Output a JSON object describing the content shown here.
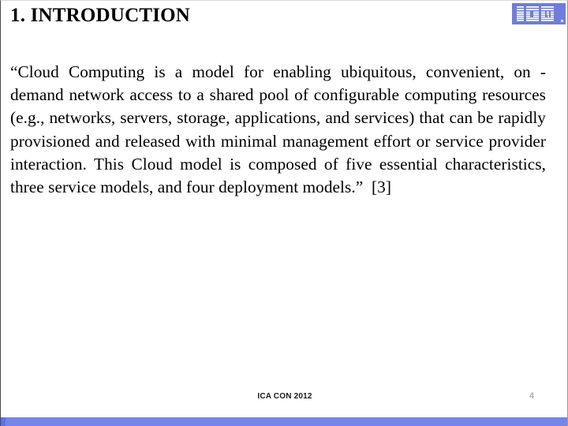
{
  "slide": {
    "title": "1. INTRODUCTION",
    "body": "“Cloud Computing is a model for enabling ubiquitous, convenient, on -demand network access to a shared pool of configurable computing resources (e.g., networks, servers, storage, applications, and services) that can be rapidly provisioned and released with minimal management effort or service provider interaction. This Cloud model is composed of five essential characteristics, three service models, and four deployment models.”  [3]",
    "logo": {
      "name": "ibm-logo",
      "text": "IBM",
      "background_color": "#6f7ddb",
      "stripe_color": "#ffffff"
    },
    "footer": {
      "conference": "ICA CON 2012",
      "page_number": "4",
      "page_number_color": "#7d89b4"
    },
    "accent_bar_color": "#7785e8",
    "background_color": "#ffffff",
    "text_color": "#000000"
  }
}
